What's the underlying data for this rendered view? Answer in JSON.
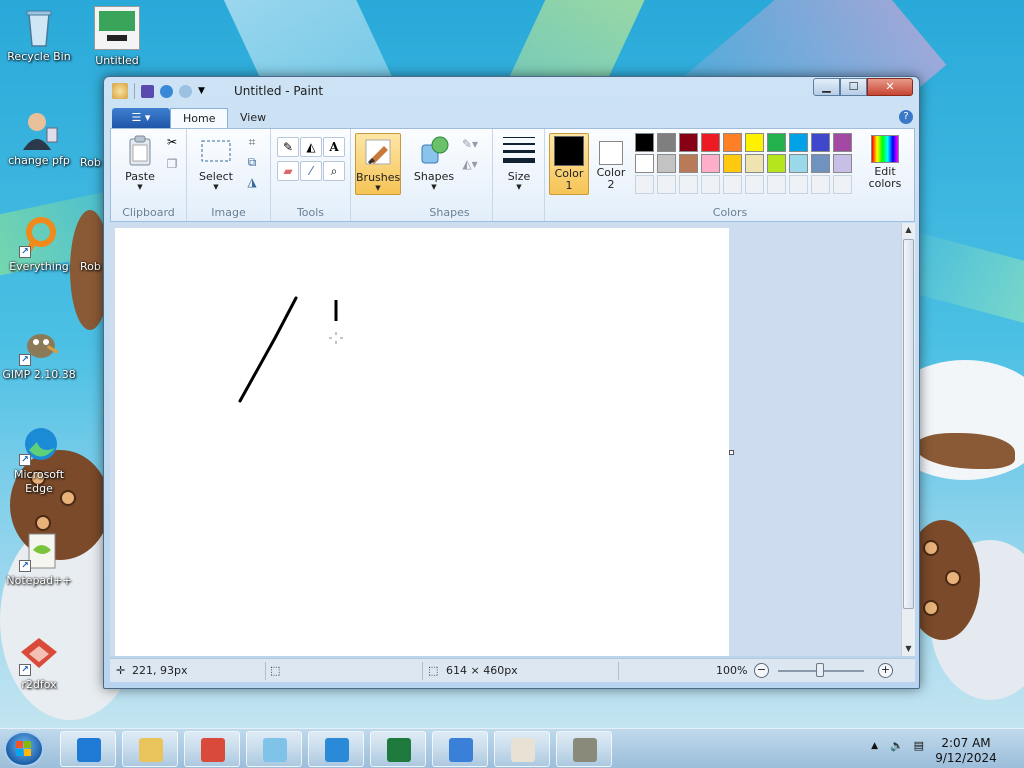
{
  "desktop": {
    "icons": [
      {
        "label": "Recycle Bin",
        "icon": "recycle-bin-icon"
      },
      {
        "label": "Untitled",
        "icon": "image-file-icon"
      },
      {
        "label": "change pfp",
        "icon": "user-icon"
      },
      {
        "label": "Rob",
        "icon": "app-icon"
      },
      {
        "label": "Everything",
        "icon": "everything-search-icon"
      },
      {
        "label": "Rob",
        "icon": "app-icon"
      },
      {
        "label": "GIMP 2.10.38",
        "icon": "gimp-icon"
      },
      {
        "label": "Microsoft Edge",
        "icon": "edge-icon"
      },
      {
        "label": "Notepad++",
        "icon": "notepadpp-icon"
      },
      {
        "label": "r2dfox",
        "icon": "r2dfox-icon"
      }
    ]
  },
  "window": {
    "title": "Untitled - Paint",
    "tabs": {
      "home": "Home",
      "view": "View"
    },
    "help": "?"
  },
  "ribbon": {
    "clipboard": {
      "label": "Clipboard",
      "paste": "Paste"
    },
    "image": {
      "label": "Image",
      "select": "Select"
    },
    "tools": {
      "label": "Tools",
      "text_tool": "A"
    },
    "brushes": "Brushes",
    "shapes": {
      "label": "Shapes",
      "button": "Shapes"
    },
    "size": "Size",
    "colors": {
      "label": "Colors",
      "color1": [
        "Color",
        "1"
      ],
      "color2": [
        "Color",
        "2"
      ],
      "edit_colors": [
        "Edit",
        "colors"
      ],
      "color1_value": "#000000",
      "color2_value": "#ffffff",
      "palette_row1": [
        "#000000",
        "#7f7f7f",
        "#880015",
        "#ed1c24",
        "#ff7f27",
        "#fff200",
        "#22b14c",
        "#00a2e8",
        "#3f48cc",
        "#a349a4"
      ],
      "palette_row2": [
        "#ffffff",
        "#c3c3c3",
        "#b97a57",
        "#ffaec9",
        "#ffc90e",
        "#efe4b0",
        "#b5e61d",
        "#99d9ea",
        "#7092be",
        "#c8bfe7"
      ]
    }
  },
  "status": {
    "cursor_pos": "221, 93px",
    "canvas_size": "614 × 460px",
    "zoom": "100%",
    "zoom_out": "−",
    "zoom_in": "+"
  },
  "taskbar": {
    "apps": [
      {
        "name": "internet-explorer",
        "color": "#1f7ad6"
      },
      {
        "name": "file-explorer",
        "color": "#e8c45a"
      },
      {
        "name": "r2dfox",
        "color": "#d94a3a"
      },
      {
        "name": "eraser-app",
        "color": "#7fc4e8"
      },
      {
        "name": "app-s",
        "color": "#2a8ad8"
      },
      {
        "name": "project",
        "color": "#1e7a3c"
      },
      {
        "name": "brightness-app",
        "color": "#3a7fd8"
      },
      {
        "name": "paint",
        "color": "#e8e2d4"
      },
      {
        "name": "gimp",
        "color": "#8a8a7a"
      }
    ],
    "time": "2:07 AM",
    "date": "9/12/2024"
  }
}
